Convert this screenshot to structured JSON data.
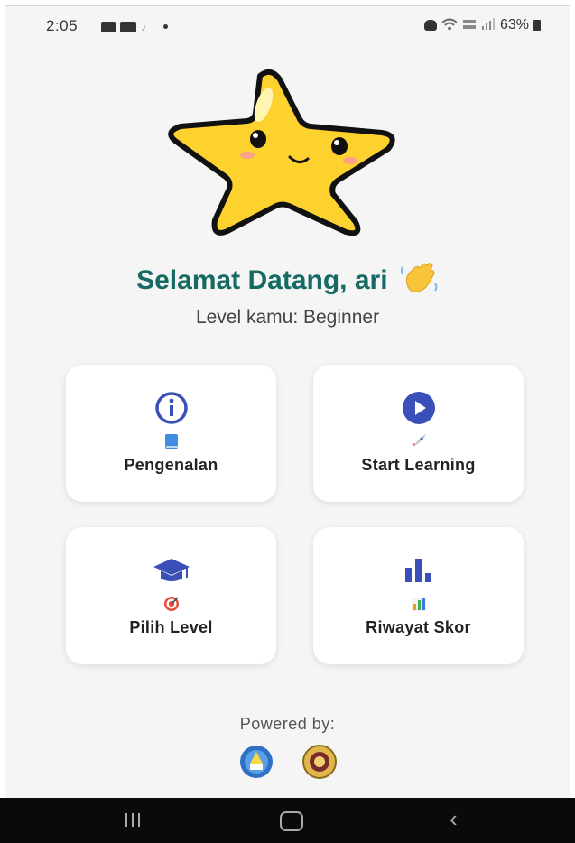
{
  "status_bar": {
    "time": "2:05",
    "battery": "63%",
    "icons": [
      "gallery-icon",
      "video-icon",
      "tiktok-icon",
      "notification-dot",
      "alarm-icon",
      "wifi-icon",
      "volte-icon",
      "signal-icon",
      "battery-icon"
    ]
  },
  "header": {
    "mascot": "star-mascot",
    "greeting": "Selamat Datang, ari",
    "greeting_emoji": "waving-hand-icon",
    "level_text": "Level kamu: Beginner"
  },
  "menu": {
    "cards": [
      {
        "label": "Pengenalan",
        "main_icon": "info-circle-icon",
        "emoji": "blue-book-icon"
      },
      {
        "label": "Start Learning",
        "main_icon": "play-circle-icon",
        "emoji": "rocket-icon"
      },
      {
        "label": "Pilih Level",
        "main_icon": "graduation-cap-icon",
        "emoji": "target-icon"
      },
      {
        "label": "Riwayat Skor",
        "main_icon": "bar-chart-icon",
        "emoji": "bar-chart-emoji-icon"
      }
    ]
  },
  "footer": {
    "powered_by": "Powered by:",
    "logos": [
      "tut-wuri-handayani-logo",
      "university-logo"
    ]
  },
  "nav_bar": {
    "buttons": [
      "recent-apps-button",
      "home-button",
      "back-button"
    ]
  },
  "colors": {
    "accent_blue": "#3b4fb8",
    "greeting_teal": "#156b64",
    "star_yellow": "#fdd12e",
    "background": "#f5f5f5"
  }
}
